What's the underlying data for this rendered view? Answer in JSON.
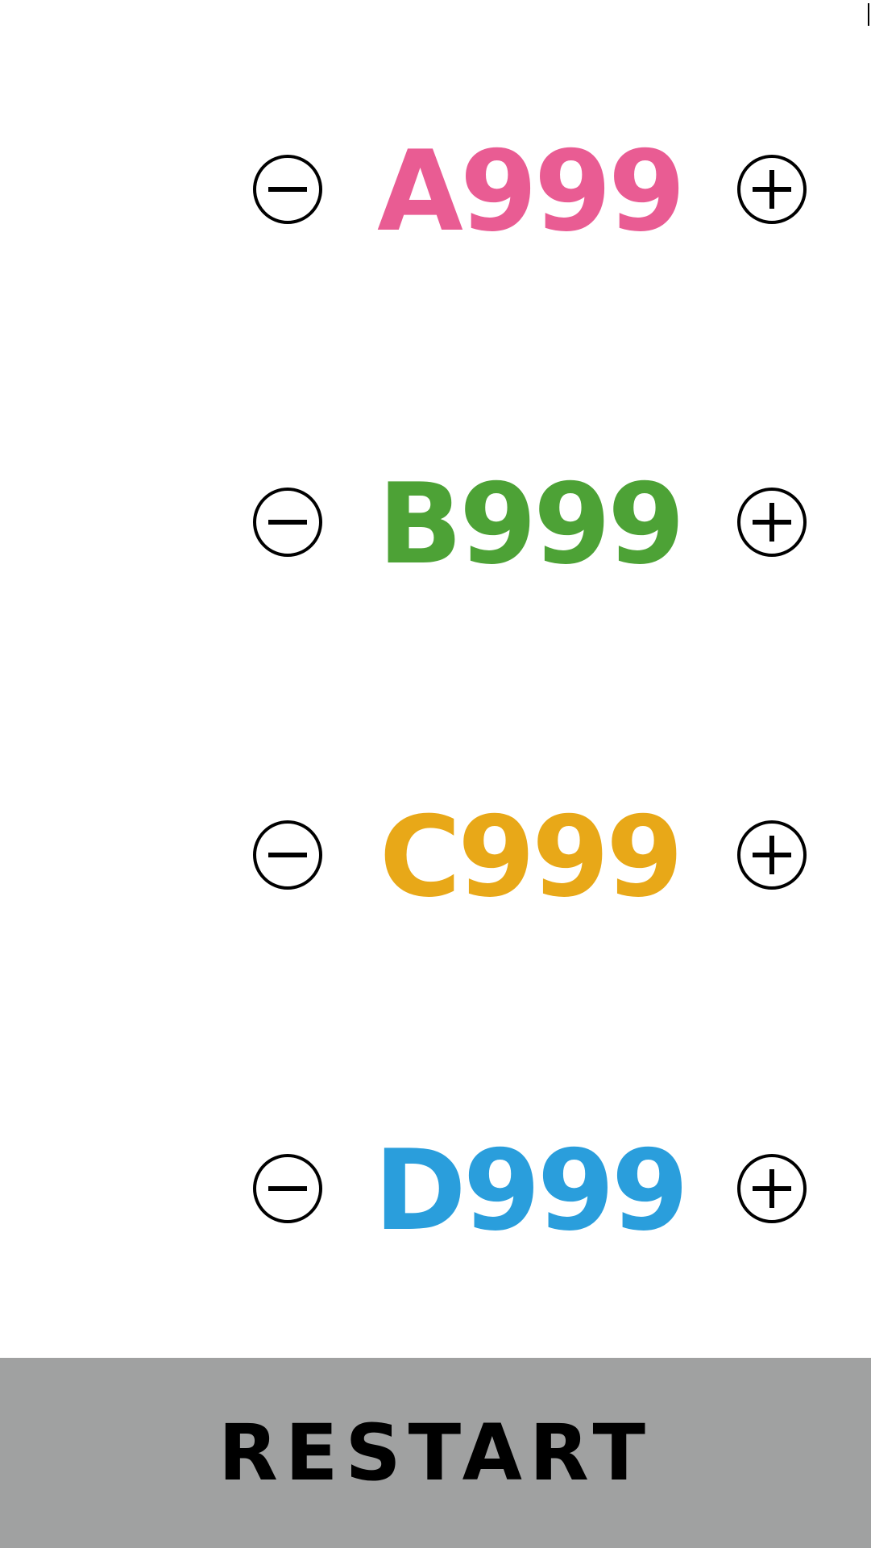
{
  "counters": [
    {
      "label": "A999",
      "color": "#e95c93",
      "minus_icon": "minus-circle-icon",
      "plus_icon": "plus-circle-icon"
    },
    {
      "label": "B999",
      "color": "#4da236",
      "minus_icon": "minus-circle-icon",
      "plus_icon": "plus-circle-icon"
    },
    {
      "label": "C999",
      "color": "#e8a818",
      "minus_icon": "minus-circle-icon",
      "plus_icon": "plus-circle-icon"
    },
    {
      "label": "D999",
      "color": "#2a9edc",
      "minus_icon": "minus-circle-icon",
      "plus_icon": "plus-circle-icon"
    }
  ],
  "restart": {
    "label": "RESTART",
    "background": "#a0a1a1"
  }
}
